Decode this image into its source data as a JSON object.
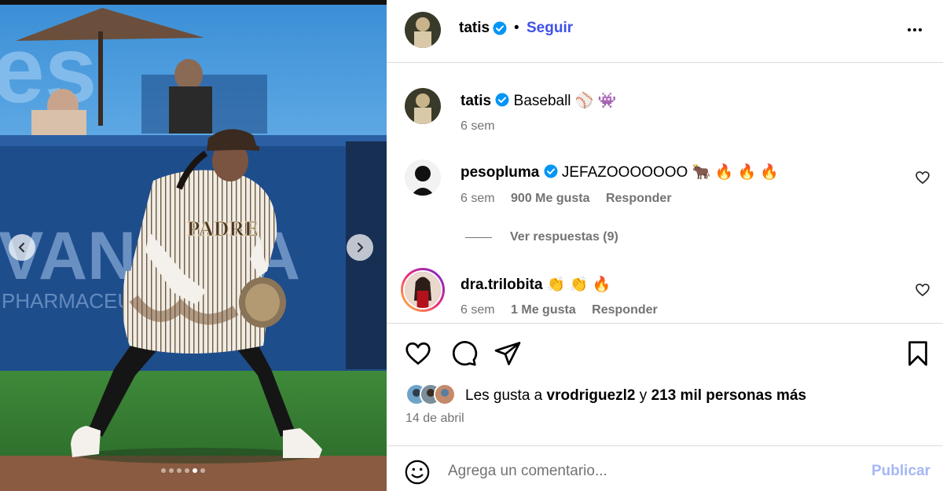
{
  "post": {
    "author": "tatis",
    "follow_label": "Seguir",
    "separator": "•",
    "carousel": {
      "slide_count": 6,
      "active_index": 4
    }
  },
  "caption": {
    "username": "tatis",
    "text": "Baseball ⚾ 👾",
    "time": "6 sem"
  },
  "comments": [
    {
      "username": "pesopluma",
      "text": "JEFAZOOOOOOO 🐂 🔥 🔥 🔥",
      "time": "6 sem",
      "likes": "900 Me gusta",
      "reply_label": "Responder",
      "view_replies": "Ver respuestas (9)"
    },
    {
      "username": "dra.trilobita",
      "text": "👏 👏 🔥",
      "time": "6 sem",
      "likes": "1 Me gusta",
      "reply_label": "Responder"
    }
  ],
  "engagement": {
    "liked_by_prefix": "Les gusta a",
    "liked_by_user": "vrodriguezl2",
    "liked_by_mid": "y",
    "liked_by_others": "213 mil personas más",
    "date": "14 de abril"
  },
  "composer": {
    "placeholder": "Agrega un comentario...",
    "publish_label": "Publicar"
  },
  "colors": {
    "accent": "#3f51e8",
    "publish_disabled": "#a5b7f5",
    "verified": "#0095f6",
    "muted": "#737373"
  },
  "icons": [
    "verified-icon",
    "more-icon",
    "heart-icon",
    "comment-icon",
    "share-icon",
    "bookmark-icon",
    "emoji-icon",
    "chevron-left-icon",
    "chevron-right-icon"
  ]
}
